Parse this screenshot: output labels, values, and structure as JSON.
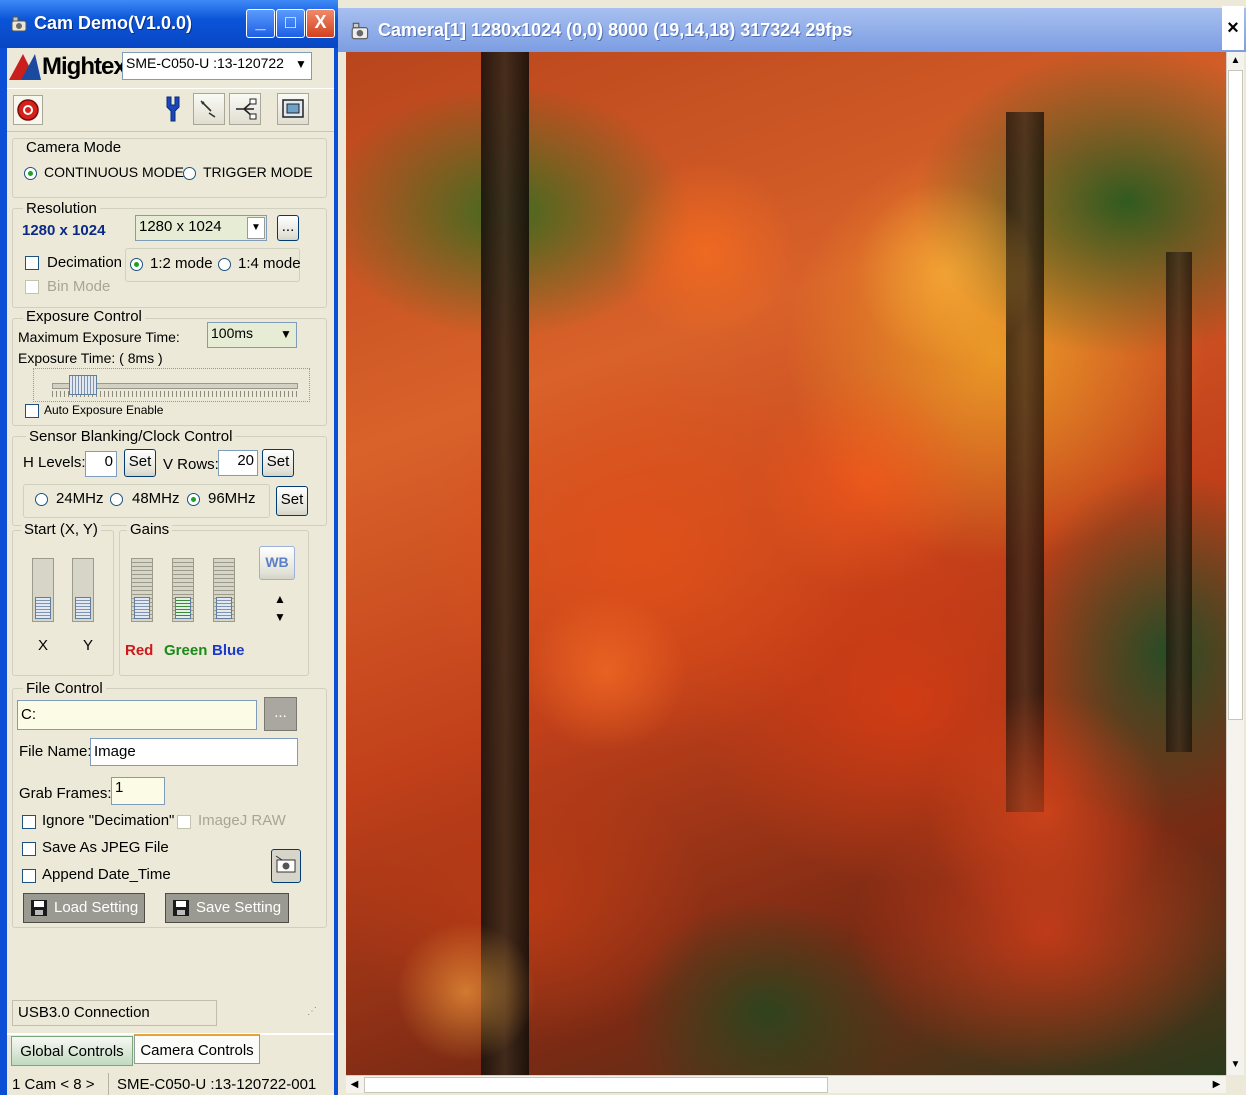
{
  "control_window": {
    "title": "Cam Demo(V1.0.0)",
    "window_buttons": [
      "_",
      "□",
      "X"
    ],
    "brand": "Mightex",
    "device_select": "SME-C050-U   :13-120722",
    "camera_mode": {
      "label": "Camera Mode",
      "options": [
        "CONTINUOUS MODE",
        "TRIGGER MODE"
      ],
      "selected": "CONTINUOUS MODE"
    },
    "resolution": {
      "label": "Resolution",
      "current": "1280 x  1024",
      "select_value": "1280 x 1024",
      "more_button": "...",
      "decimation_label": "Decimation",
      "decimation_modes": [
        "1:2 mode",
        "1:4 mode"
      ],
      "decimation_selected": "1:2 mode",
      "bin_mode_label": "Bin Mode"
    },
    "exposure": {
      "label": "Exposure Control",
      "max_label": "Maximum  Exposure Time:",
      "max_value": "100ms",
      "time_label": "Exposure Time: ( 8ms )",
      "slider_fraction": 0.08,
      "auto_label": "Auto Exposure Enable"
    },
    "blanking": {
      "label": "Sensor Blanking/Clock Control",
      "h_label": "H Levels:",
      "h_value": "0",
      "v_label": "V Rows:",
      "v_value": "20",
      "set_label": "Set",
      "clocks": [
        "24MHz",
        "48MHz",
        "96MHz"
      ],
      "clock_selected": "96MHz"
    },
    "start": {
      "label": "Start (X, Y)",
      "x_label": "X",
      "y_label": "Y"
    },
    "gains": {
      "label": "Gains",
      "wb_label": "WB",
      "red_label": "Red",
      "green_label": "Green",
      "blue_label": "Blue",
      "red_color": "#cc1a1a",
      "green_color": "#1a8a1a",
      "blue_color": "#1a3acc"
    },
    "file": {
      "label": "File Control",
      "path": "C:",
      "browse": "...",
      "name_label": "File Name:",
      "name_value": "Image",
      "grab_label": "Grab Frames:",
      "grab_value": "1",
      "ignore_decimation": "Ignore \"Decimation\"",
      "imagej_raw": "ImageJ RAW",
      "save_jpeg": "Save As JPEG File",
      "append_date": "Append Date_Time",
      "load_setting": "Load Setting",
      "save_setting": "Save Setting"
    },
    "status": "USB3.0 Connection",
    "tabs": [
      "Global  Controls",
      "Camera Controls"
    ],
    "active_tab": "Global  Controls",
    "statusbar": [
      "1 Cam < 8 >",
      "SME-C050-U   :13-120722-001"
    ]
  },
  "camera_window": {
    "title": "Camera[1]   1280x1024 (0,0) 8000 (19,14,18) 317324 29fps",
    "close": "×"
  }
}
